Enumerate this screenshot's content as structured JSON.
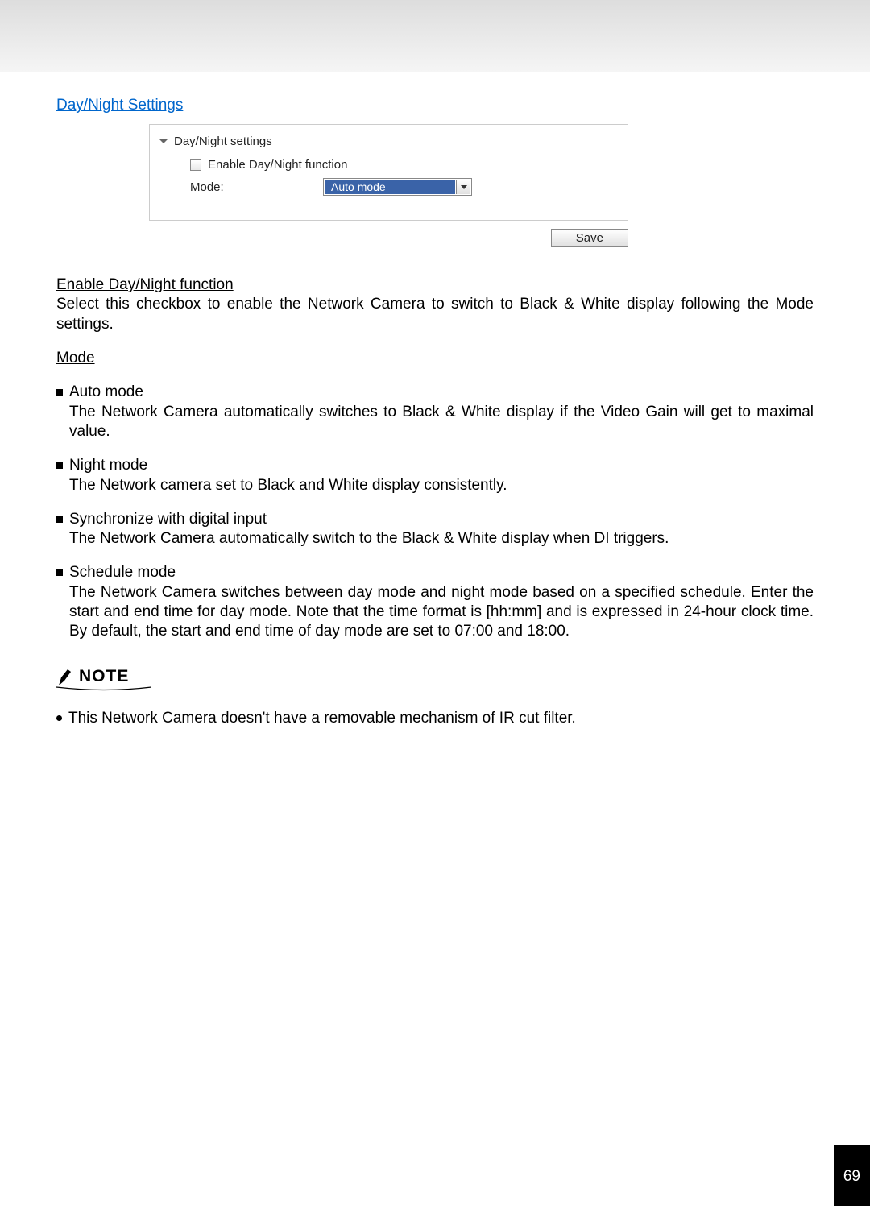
{
  "section_title": "Day/Night Settings",
  "panel": {
    "header": "Day/Night settings",
    "enable_label": "Enable Day/Night function",
    "mode_label": "Mode:",
    "mode_selected": "Auto mode"
  },
  "save_label": "Save",
  "enable_heading": "Enable Day/Night function",
  "enable_desc": "Select this checkbox to enable the Network Camera to switch to Black & White display following the Mode settings.",
  "mode_heading": "Mode",
  "modes": [
    {
      "title": "Auto mode",
      "desc": "The Network Camera automatically switches to Black & White display if the Video Gain will get to maximal value.",
      "justify": true
    },
    {
      "title": "Night mode",
      "desc": "The Network camera set to Black and White display consistently.",
      "justify": false
    },
    {
      "title": "Synchronize with digital input",
      "desc": "The Network Camera automatically switch to the Black & White display when DI triggers.",
      "justify": false
    },
    {
      "title": "Schedule mode",
      "desc": "The Network Camera switches between day mode and night mode based on a specified schedule. Enter the start and end time for day mode. Note that the time format is [hh:mm] and is expressed in 24-hour clock time. By default, the start and end time of day mode are set to 07:00 and 18:00.",
      "justify": true
    }
  ],
  "note_label": "NOTE",
  "note_text": "This Network Camera doesn't have a removable mechanism of IR cut filter.",
  "page_number": "69"
}
